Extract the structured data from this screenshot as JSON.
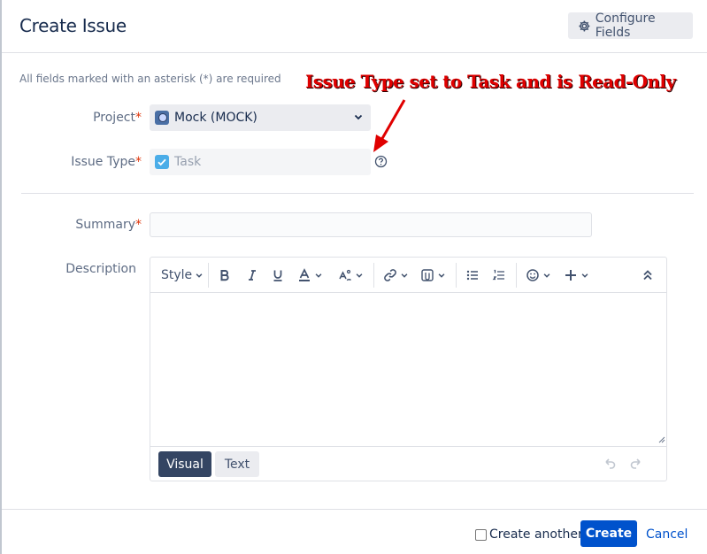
{
  "dialog": {
    "title": "Create Issue",
    "configure_fields_label": "Configure Fields"
  },
  "form": {
    "required_note": "All fields marked with an asterisk (*) are required",
    "project": {
      "label": "Project",
      "required_mark": "*",
      "value": "Mock (MOCK)"
    },
    "issue_type": {
      "label": "Issue Type",
      "required_mark": "*",
      "value": "Task",
      "read_only": true
    },
    "summary": {
      "label": "Summary",
      "required_mark": "*",
      "value": ""
    },
    "description": {
      "label": "Description"
    }
  },
  "annotation": {
    "text": "Issue Type set to Task and is Read-Only",
    "color": "#e00000"
  },
  "editor": {
    "toolbar": {
      "style_label": "Style",
      "icons": [
        "bold-icon",
        "italic-icon",
        "underline-icon",
        "text-color-icon",
        "text-format-icon",
        "link-icon",
        "attachment-icon",
        "bullet-list-icon",
        "numbered-list-icon",
        "emoji-icon",
        "insert-plus-icon",
        "collapse-toolbar-icon"
      ]
    },
    "mode_visual_label": "Visual",
    "mode_text_label": "Text",
    "active_mode": "Visual"
  },
  "footer": {
    "create_another_label": "Create another",
    "create_another_checked": false,
    "create_label": "Create",
    "cancel_label": "Cancel"
  },
  "colors": {
    "primary": "#0052cc",
    "required": "#de350b",
    "text": "#172b4d",
    "muted": "#5e6c84"
  }
}
